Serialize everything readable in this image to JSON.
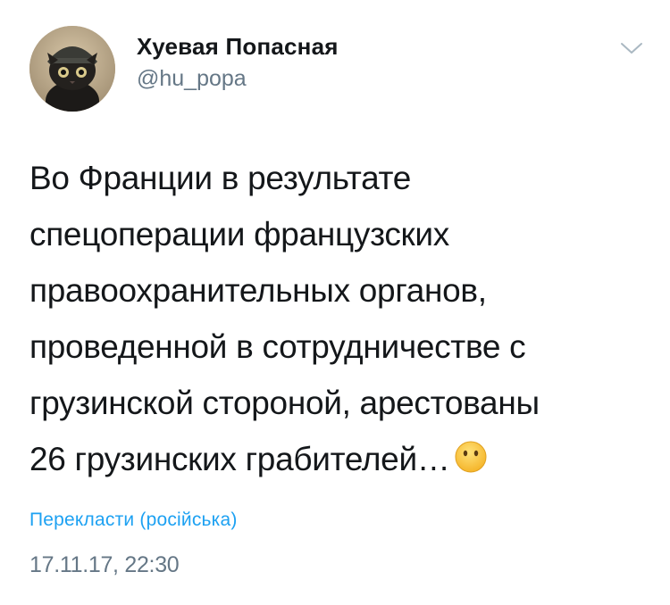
{
  "tweet": {
    "author": {
      "display_name": "Хуевая Попасная",
      "handle": "@hu_popa",
      "avatar_icon": "cat-avatar"
    },
    "menu_icon": "chevron-down-icon",
    "text_lines": [
      "Во Франции в результате",
      "спецоперации французских",
      "правоохранительных органов,",
      "проведенной в сотрудничестве с",
      "грузинской стороной, арестованы",
      "26 грузинских грабителей…"
    ],
    "emoji": "hushed-face",
    "translate_label": "Перекласти (російська)",
    "timestamp": "17.11.17, 22:30"
  },
  "colors": {
    "link": "#1da1f2",
    "muted": "#657786",
    "text": "#14171a"
  }
}
